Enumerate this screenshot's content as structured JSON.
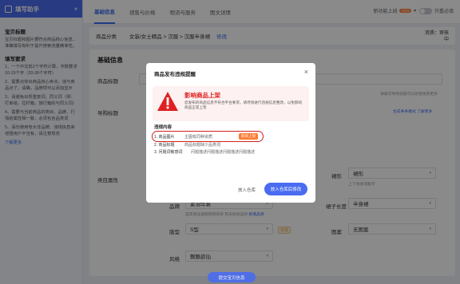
{
  "sidebar": {
    "header": "填写助手",
    "section1_title": "宝贝标题",
    "section1_text": "宝贝标题和图片要符合商品核心信息，准确填写有利于提升搜索流量精准性。",
    "section2_title": "填写要求",
    "req1": "1、一个中文抵2个字符计算，字数要求10-15个字（20-30个字符）",
    "req2": "2、需要点突出商品核心卖点，违与商品对了，请确，品牌项可以添加显示",
    "req3": "3、请避免出现重复词、同义词（例：打单组，拉杆箱，旅行箱的与同义词）",
    "req4": "4、需要与当前商品的类目、品牌、行情结属性相一致，必须包含品类词",
    "req5": "5、请勿使用夸大非品牌、违规信息来增强用户不当有，请注意规范",
    "more": "了解更多"
  },
  "tabs": [
    "基础信息",
    "销售与价格",
    "物流与服务",
    "图文详情"
  ],
  "topright": {
    "new_label": "新功能上线",
    "new_badge": "NEW",
    "only_required": "只看必填"
  },
  "category": {
    "label": "商品分类",
    "path": "女装/女士精品 > 汉服 > 汉服半身裙",
    "edit": "修改",
    "qualification": "资质：审核中"
  },
  "form": {
    "section_title": "基础信息",
    "title_label": "商品标题",
    "guide_label": "导购标题",
    "attr_label": "类目属性",
    "brand_label": "品牌",
    "brand_value": "素羽华裳",
    "brand_hint": "提高商品搜索购物效率   若未找到品牌",
    "brand_link": "新增品牌",
    "shape_label": "版型",
    "shape_value": "S型",
    "shape_tag": "有错",
    "silhouette_label": "裙形",
    "silhouette_value": "裙形",
    "silhouette_hint": "上下身收敛截窄",
    "length_label": "裙子长度",
    "length_value": "半身裙",
    "pattern_label": "图案",
    "pattern_value": "无图案",
    "style_label": "风格",
    "style_value": "飘飘欲仙",
    "hint_right": "生成条条模式   了解更多",
    "fill_suggestion": "请填写导购标题可以改善搜索更多"
  },
  "modal": {
    "title": "商品发布违规提醒",
    "close": "×",
    "warn_title": "影响商品上架",
    "warn_text": "您发布的商品信息不符合平台要求，请尽快进行违规信息整改，以免影响商品正常上架",
    "violations_title": "违规内容",
    "violations": [
      {
        "name": "1. 商品图片",
        "desc": "主图有同种资质",
        "badge": "影响上架"
      },
      {
        "name": "2. 商品标题",
        "desc": "商品标题缺少品类词"
      },
      {
        "name": "3. 问题词敏感词",
        "desc": "问题描述问题描述问题描述问题描述"
      }
    ],
    "btn_draft": "放入仓库",
    "btn_ok": "放入仓库后修改"
  },
  "submit": "提交宝贝信息"
}
